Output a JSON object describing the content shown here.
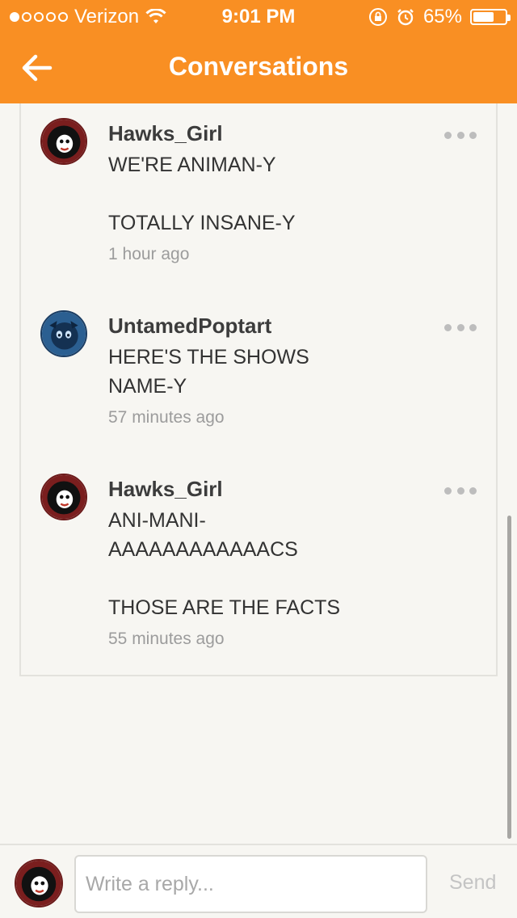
{
  "status": {
    "carrier": "Verizon",
    "time": "9:01 PM",
    "battery": "65%",
    "battery_level": 0.65
  },
  "nav": {
    "title": "Conversations",
    "back_icon": "arrow-left-icon"
  },
  "colors": {
    "brand": "#f98f23",
    "text": "#333333",
    "muted": "#9c9c9c"
  },
  "comments": [
    {
      "author": "Hawks_Girl",
      "body": "WE'RE ANIMAN-Y\n\nTOTALLY INSANE-Y",
      "time": "1 hour ago",
      "avatar": "cartoon-avatar-icon"
    },
    {
      "author": "UntamedPoptart",
      "body": "HERE'S THE SHOWS\nNAME-Y",
      "time": "57 minutes ago",
      "avatar": "blue-cartoon-avatar-icon"
    },
    {
      "author": "Hawks_Girl",
      "body": "ANI-MANI-\nAAAAAAAAAAAACS\n\nTHOSE ARE THE FACTS",
      "time": "55 minutes ago",
      "avatar": "cartoon-avatar-icon"
    }
  ],
  "reply": {
    "placeholder": "Write a reply...",
    "send_label": "Send"
  }
}
